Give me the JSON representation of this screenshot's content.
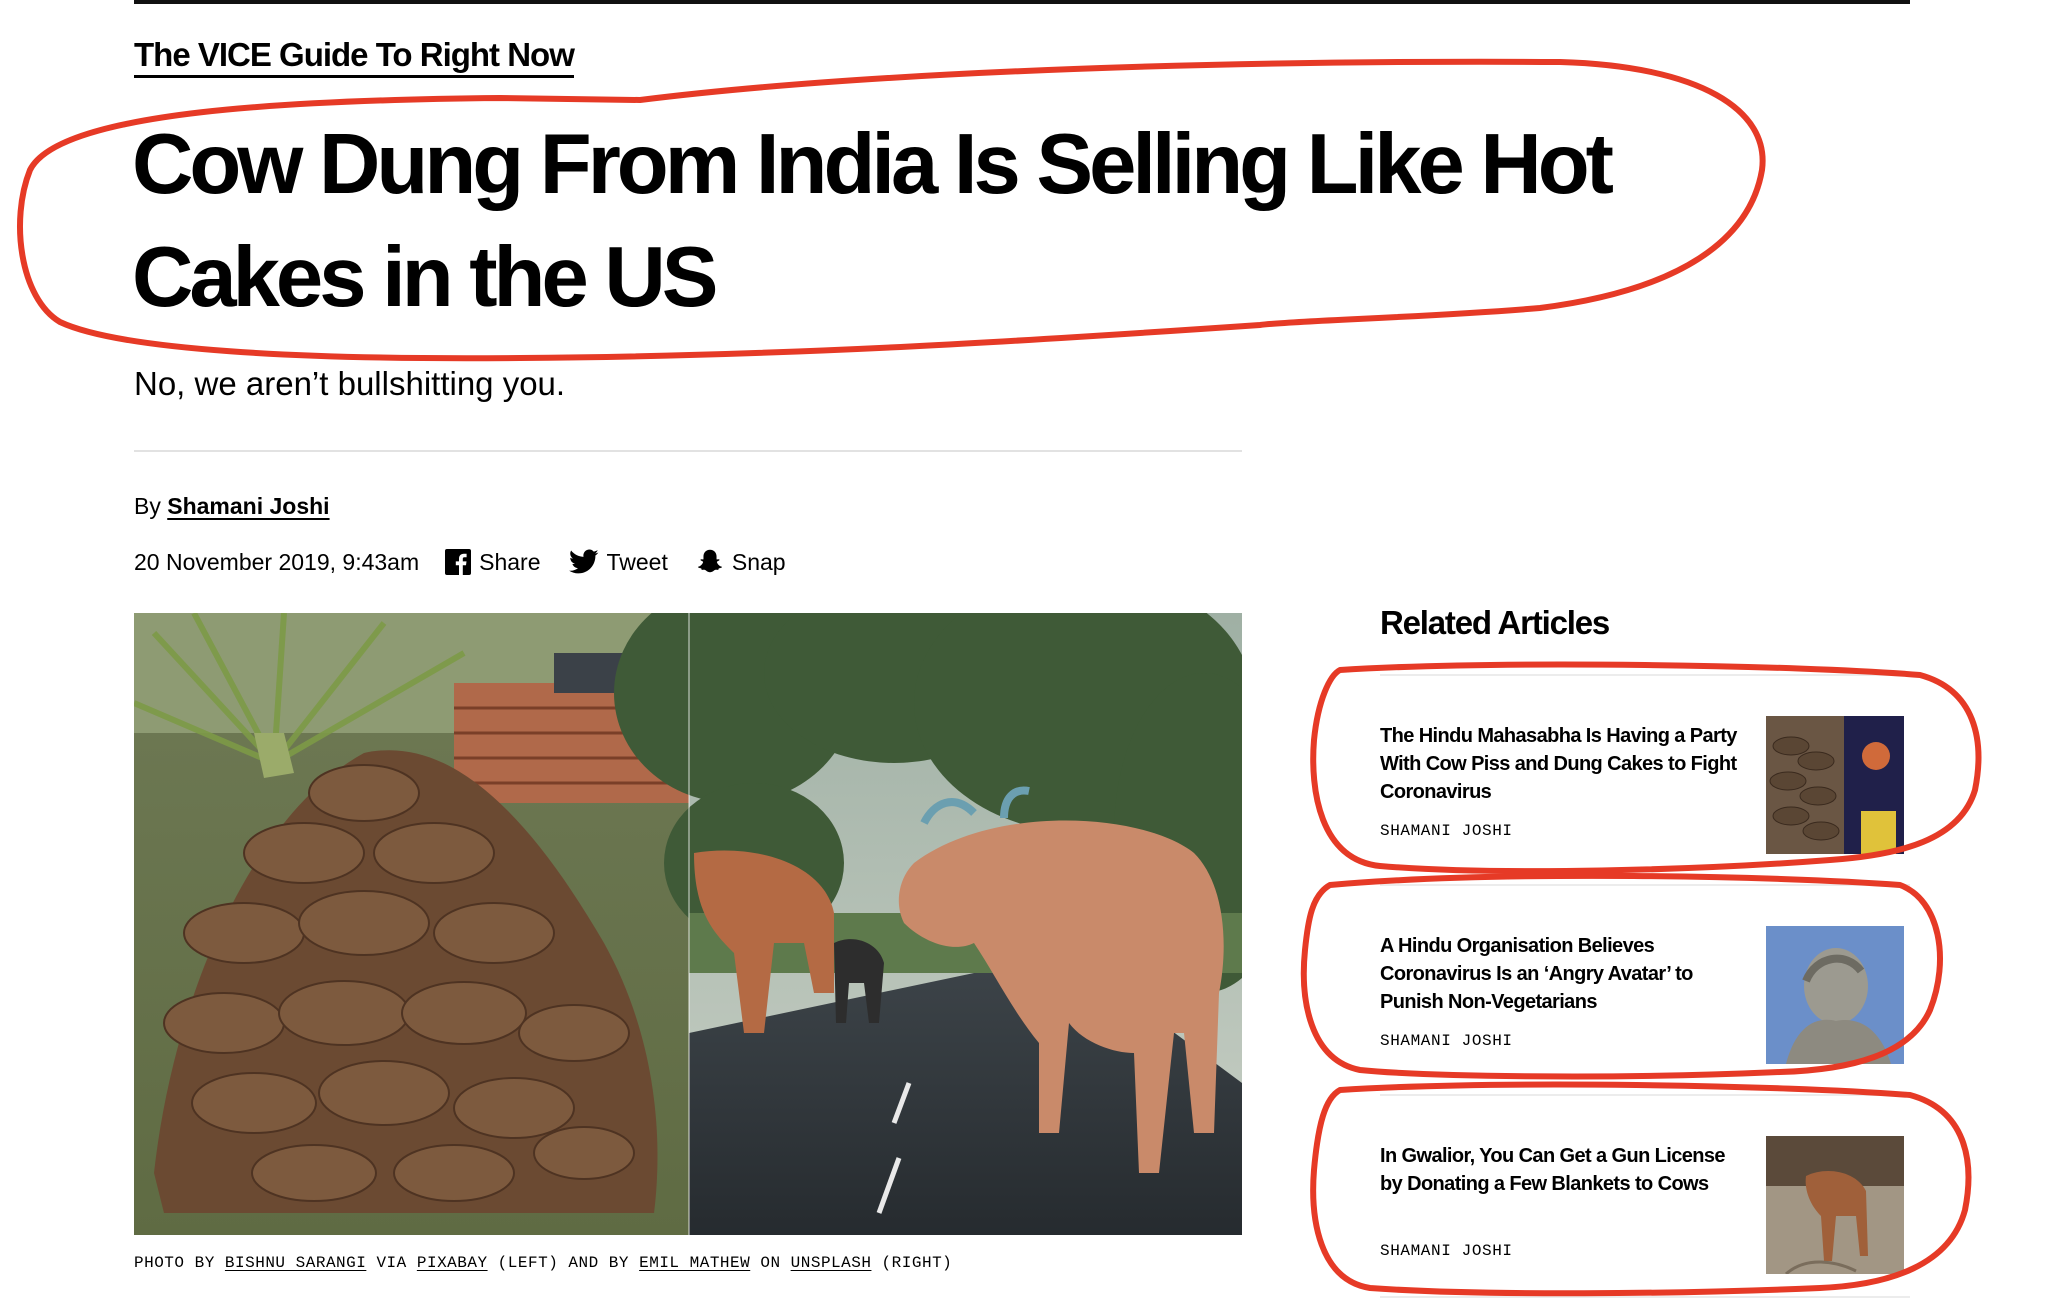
{
  "section": {
    "label": "The VICE Guide To Right Now"
  },
  "article": {
    "headline": "Cow Dung From India Is Selling Like Hot Cakes in the US",
    "dek": "No, we aren’t bullshitting you.",
    "by_prefix": "By",
    "author": "Shamani Joshi",
    "date": "20 November 2019, 9:43am"
  },
  "share": {
    "facebook": "Share",
    "twitter": "Tweet",
    "snapchat": "Snap"
  },
  "caption": {
    "p1": "PHOTO BY ",
    "link1": "BISHNU SARANGI",
    "p2": " VIA ",
    "link2": "PIXABAY",
    "p3": " (LEFT) AND BY ",
    "link3": "EMIL MATHEW",
    "p4": " ON ",
    "link4": "UNSPLASH",
    "p5": " (RIGHT)"
  },
  "related": {
    "heading": "Related Articles",
    "items": [
      {
        "title": "The Hindu Mahasabha Is Having a Party With Cow Piss and Dung Cakes to Fight Coronavirus",
        "author": "SHAMANI JOSHI"
      },
      {
        "title": "A Hindu Organisation Believes Coronavirus Is an ‘Angry Avatar’ to Punish Non-Vegetarians",
        "author": "SHAMANI JOSHI"
      },
      {
        "title": "In Gwalior, You Can Get a Gun License by Donating a Few Blankets to Cows",
        "author": "SHAMANI JOSHI"
      }
    ]
  },
  "colors": {
    "annotation": "#e63a26",
    "text": "#000000",
    "rule": "#e2e2e2"
  }
}
